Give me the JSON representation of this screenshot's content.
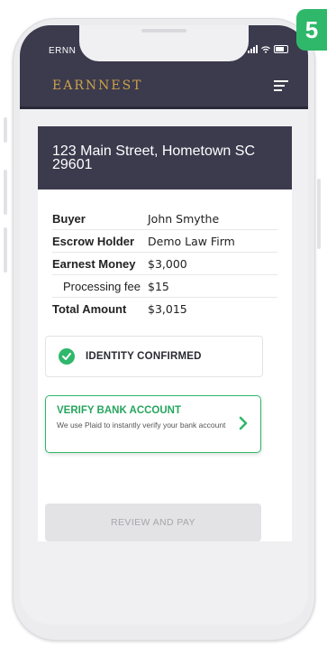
{
  "step_badge": "5",
  "status_bar": {
    "carrier": "ERNN"
  },
  "app_bar": {
    "logo": "EARNNEST",
    "menu_icon": "hamburger-menu-icon"
  },
  "property": {
    "address": "123 Main Street, Hometown SC 29601"
  },
  "details": [
    {
      "label": "Buyer",
      "value": "John Smythe"
    },
    {
      "label": "Escrow Holder",
      "value": "Demo Law Firm"
    },
    {
      "label": "Earnest Money",
      "value": "$3,000"
    },
    {
      "label": "Processing fee",
      "value": "$15"
    },
    {
      "label": "Total Amount",
      "value": "$3,015"
    }
  ],
  "identity": {
    "label": "IDENTITY CONFIRMED",
    "icon": "check-circle-icon"
  },
  "verify_bank": {
    "title": "VERIFY BANK ACCOUNT",
    "description": "We use Plaid to instantly verify your bank account",
    "icon": "chevron-right-icon"
  },
  "review_button": {
    "label": "REVIEW AND PAY"
  },
  "colors": {
    "brand_dark": "#3c3a4d",
    "logo_gold": "#c9a24a",
    "success_green": "#2fb86a",
    "disabled_gray": "#e3e3e6"
  }
}
